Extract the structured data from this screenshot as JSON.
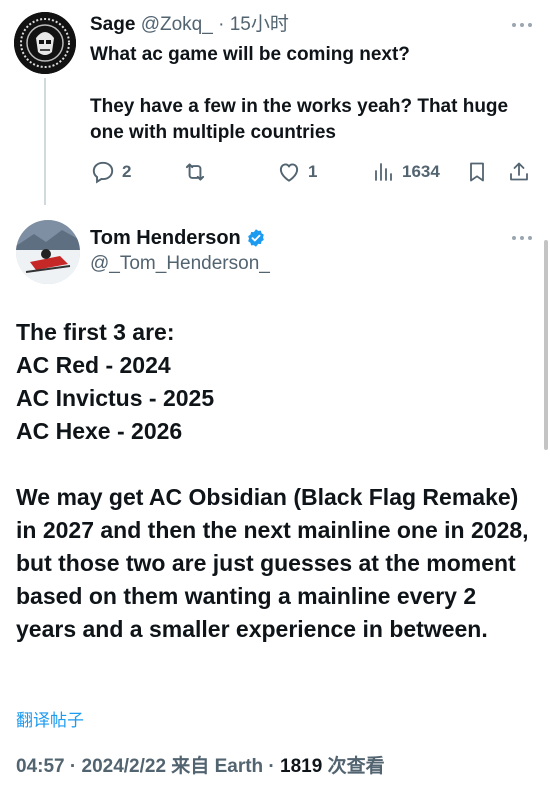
{
  "reply": {
    "name": "Sage",
    "handle": "@Zokq_",
    "separator": " · ",
    "time": "15小时",
    "text_line1": "What ac game will be coming next?",
    "text_line2": "They have a few in the works yeah? That huge one with multiple countries",
    "actions": {
      "replies": "2",
      "likes": "1",
      "views": "1634"
    }
  },
  "tweet": {
    "name": "Tom Henderson",
    "handle": "@_Tom_Henderson_",
    "verified": true,
    "lines": [
      "The first 3 are:",
      "AC Red - 2024",
      "AC Invictus - 2025",
      "AC Hexe - 2026"
    ],
    "paragraph": "We may get AC Obsidian (Black Flag Remake) in 2027 and then the next mainline one in 2028, but those two are just guesses at the moment based on them wanting a mainline every 2 years and a smaller experience in between.",
    "translate_label": "翻译帖子",
    "meta_time": "04:57",
    "meta_sep": " · ",
    "meta_date": "2024/2/22",
    "meta_source": " 来自 Earth",
    "meta_sep2": " · ",
    "meta_views_count": "1819",
    "meta_views_label": " 次查看"
  },
  "colors": {
    "text": "#0f1419",
    "muted": "#536471",
    "link": "#1d9bf0",
    "verified": "#1d9bf0",
    "thread_line": "#cfd9de"
  }
}
